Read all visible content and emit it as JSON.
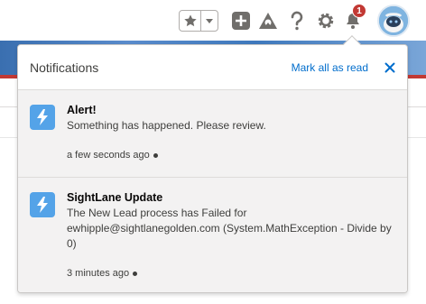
{
  "header": {
    "favorites_icon": "star-icon",
    "favorites_menu_icon": "chevron-down-icon",
    "global_actions_icon": "plus-icon",
    "trailhead_icon": "trailhead-icon",
    "help_icon": "question-icon",
    "setup_icon": "gear-icon",
    "notifications_icon": "bell-icon",
    "notification_count": "1",
    "avatar_icon": "astro-avatar-icon"
  },
  "panel": {
    "title": "Notifications",
    "mark_all_label": "Mark all as read",
    "close_icon": "close-icon"
  },
  "notifications": [
    {
      "icon": "lightning-icon",
      "title": "Alert!",
      "body": "Something has happened. Please review.",
      "time": "a few seconds ago"
    },
    {
      "icon": "lightning-icon",
      "title": "SightLane Update",
      "body": "The New Lead process has Failed for ewhipple@sightlanegolden.com (System.MathException - Divide by 0)",
      "time": "3 minutes ago"
    }
  ],
  "colors": {
    "accent": "#006dcc",
    "notif_icon_bg": "#54a3e8",
    "badge": "#c23934",
    "unread_bg": "#f3f2f2"
  }
}
